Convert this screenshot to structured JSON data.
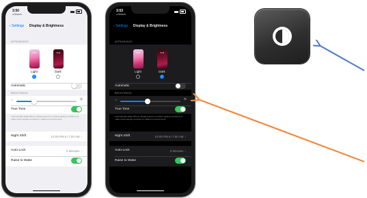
{
  "phones": {
    "light": {
      "status_time": "3:50",
      "status_back": "◂ Search",
      "nav_back": "Settings",
      "nav_title": "Display & Brightness",
      "appearance_header": "APPEARANCE",
      "thumb_time": "9:41",
      "light_label": "Light",
      "dark_label": "Dark",
      "automatic_label": "Automatic",
      "brightness_header": "BRIGHTNESS",
      "true_tone_label": "True Tone",
      "true_tone_note": "Automatically adapt iPhone display based on ambient lighting conditions to make colors appear consistent in different environments.",
      "night_shift_label": "Night Shift",
      "night_shift_value": "10:00 PM to 7:00 AM",
      "auto_lock_label": "Auto-Lock",
      "auto_lock_value": "5 Minutes",
      "raise_to_wake_label": "Raise to Wake",
      "selected_appearance": "Light",
      "automatic_on": false,
      "true_tone_on": true,
      "raise_to_wake_on": true,
      "brightness_level": 0.3
    },
    "dark": {
      "status_time": "3:53",
      "status_back": "◂ Search",
      "nav_back": "Settings",
      "nav_title": "Display & Brightness",
      "appearance_header": "APPEARANCE",
      "thumb_time": "9:41",
      "light_label": "Light",
      "dark_label": "Dark",
      "automatic_label": "Automatic",
      "brightness_header": "BRIGHTNESS",
      "true_tone_label": "True Tone",
      "true_tone_note": "Automatically adapt iPhone display based on ambient lighting conditions to make colors appear consistent in different environments.",
      "night_shift_label": "Night Shift",
      "night_shift_value": "10:00 PM to 7:00 AM",
      "auto_lock_label": "Auto-Lock",
      "auto_lock_value": "5 Minutes",
      "raise_to_wake_label": "Raise to Wake",
      "selected_appearance": "Dark",
      "automatic_on": false,
      "true_tone_on": true,
      "raise_to_wake_on": true,
      "brightness_level": 0.45
    }
  },
  "icon_tile": {
    "icon": "dark-mode-toggle-icon"
  },
  "arrows": {
    "blue_color": "#4a78c2",
    "orange_color": "#f0883e"
  },
  "colors": {
    "ios_blue": "#007aff",
    "toggle_green": "#34c759"
  }
}
